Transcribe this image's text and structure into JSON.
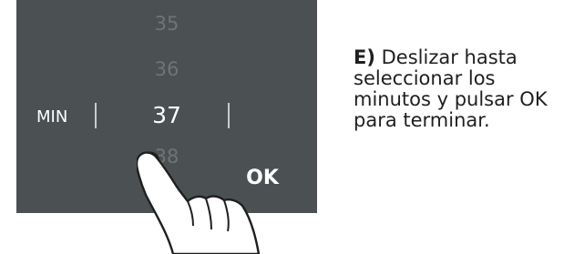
{
  "picker": {
    "unit_label": "MIN",
    "values": [
      "35",
      "36",
      "37",
      "38",
      "3"
    ],
    "selected": "37",
    "ok_label": "OK"
  },
  "instruction": {
    "step": "E)",
    "text": "Deslizar hasta seleccionar los minutos y pulsar OK para terminar."
  },
  "colors": {
    "screen_bg": "#4b5052",
    "dim_number": "#6f7577",
    "selected_number": "#ffffff"
  },
  "icons": {
    "gesture": "finger-swipe-icon"
  }
}
